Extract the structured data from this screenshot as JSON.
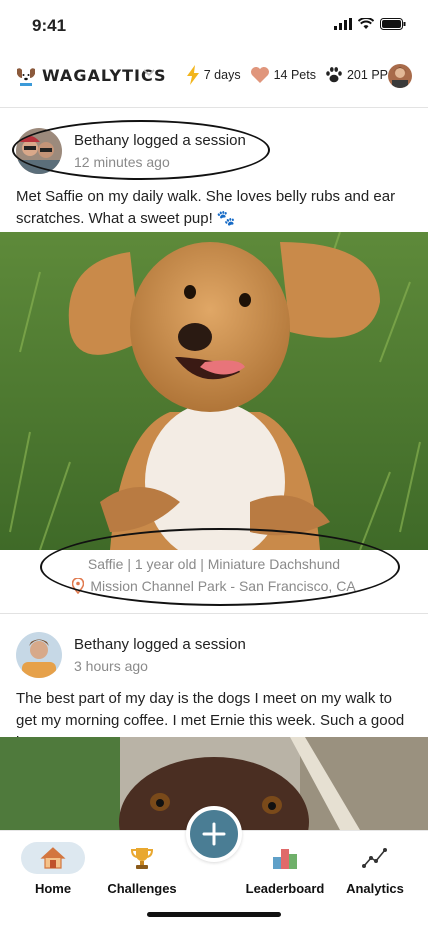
{
  "status": {
    "time": "9:41"
  },
  "header": {
    "brand": "WAGALYTICS",
    "streak": "7 days",
    "pets": "14 Pets",
    "points": "201 PP"
  },
  "posts": [
    {
      "author": "Bethany logged a session",
      "ago": "12 minutes ago",
      "text": "Met Saffie on my daily walk. She loves belly rubs and ear scratches. What a sweet pup! 🐾",
      "pet_info": "Saffie | 1 year old | Miniature Dachshund",
      "location": "Mission Channel Park - San Francisco, CA"
    },
    {
      "author": "Bethany logged a session",
      "ago": "3 hours ago",
      "text": "The best part of my day is the dogs I meet on my walk to get my morning coffee. I met Ernie this week. Such a good boy!"
    }
  ],
  "tabs": {
    "home": "Home",
    "challenges": "Challenges",
    "leaderboard": "Leaderboard",
    "analytics": "Analytics"
  },
  "colors": {
    "accent": "#4a7d94",
    "home_pill": "#dde8f0",
    "pin": "#e07a4f"
  }
}
